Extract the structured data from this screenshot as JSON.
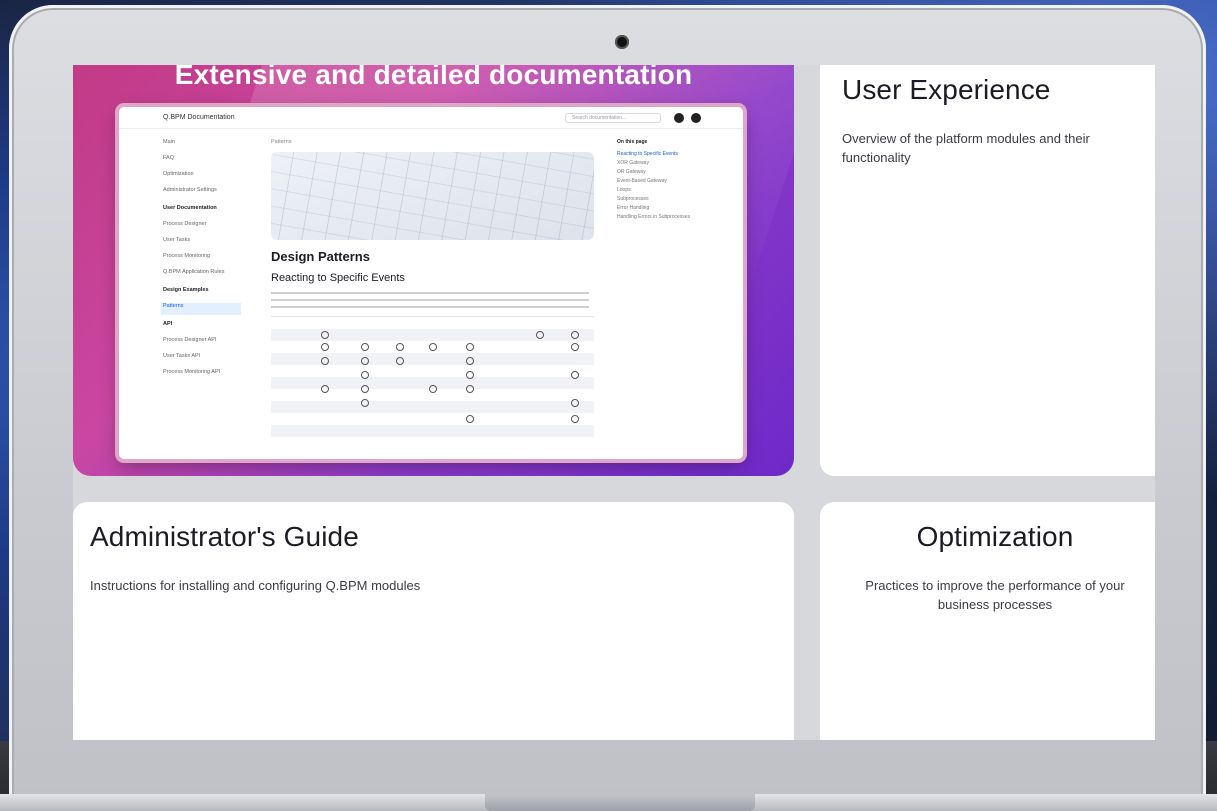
{
  "feature": {
    "title": "Extensive and detailed documentation",
    "screenshot": {
      "brand": "Q.BPM Documentation",
      "search_placeholder": "Search documentation...",
      "breadcrumb": "Patterns",
      "heading": "Design Patterns",
      "subheading": "Reacting to Specific Events",
      "sidebar": [
        "Main",
        "FAQ",
        "Optimization",
        "Administrator Settings",
        "User Documentation",
        "Process Designer",
        "User Tasks",
        "Process Monitoring",
        "Q.BPM Application Rules",
        "Design Examples",
        "Patterns",
        "API",
        "Process Designer API",
        "User Tasks API",
        "Process Monitoring API"
      ],
      "toc_title": "On this page",
      "toc": [
        "Reacting to Specific Events",
        "XOR Gateway",
        "OR Gateway",
        "Event-Based Gateway",
        "Loops",
        "Subprocesses",
        "Error Handling",
        "Handling Errors in Subprocesses"
      ]
    }
  },
  "cards": {
    "user_experience": {
      "title": "User Experience",
      "description": "Overview of the platform modules and their functionality"
    },
    "administrators_guide": {
      "title": "Administrator's Guide",
      "description": "Instructions for installing and configuring Q.BPM modules"
    },
    "optimization": {
      "title": "Optimization",
      "description": "Practices to improve the performance of your business processes"
    }
  },
  "colors": {
    "feature_gradient_start": "#c23a86",
    "feature_gradient_end": "#6d29c8",
    "card_background": "#ffffff",
    "link_blue": "#1a5fd6"
  },
  "icons": [
    "camera-icon",
    "github-icon",
    "theme-toggle-icon"
  ]
}
